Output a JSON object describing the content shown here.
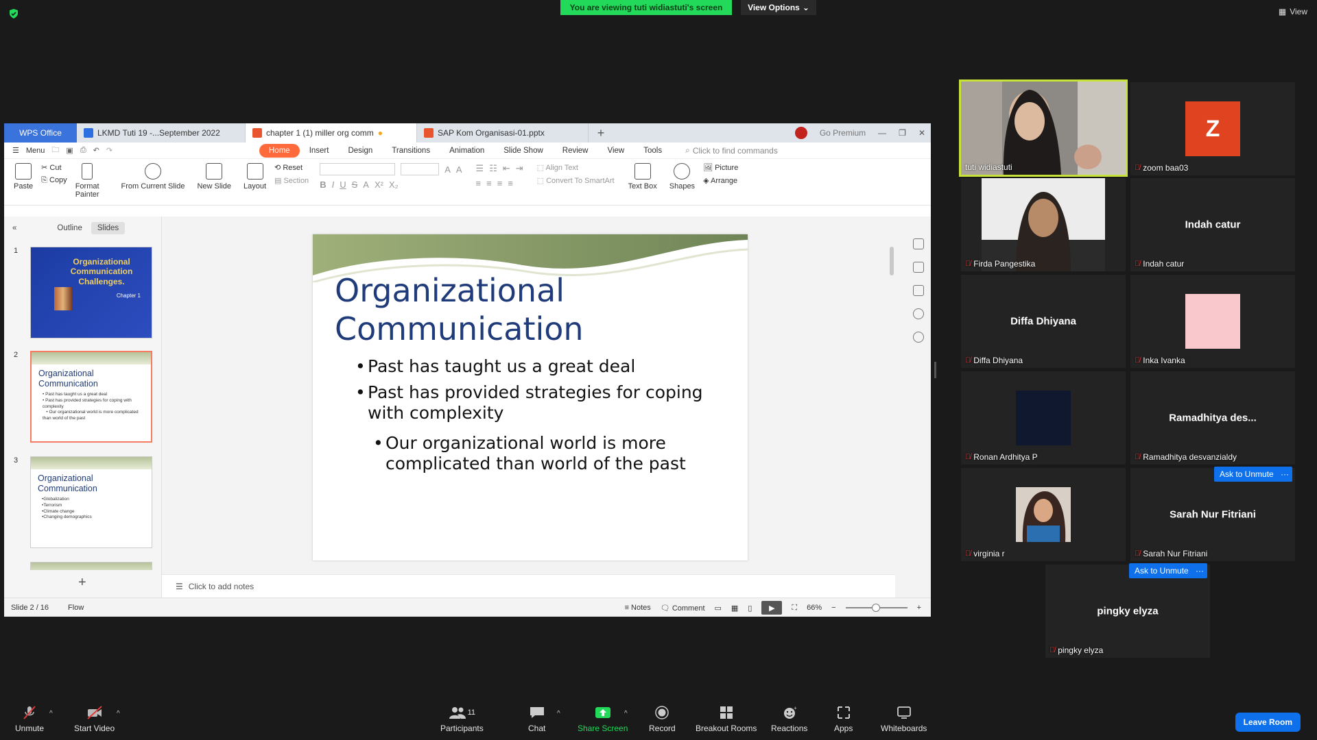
{
  "top": {
    "viewing_banner": "You are viewing tuti widiastuti's screen",
    "view_options": "View Options",
    "view": "View"
  },
  "wps": {
    "tabs": [
      {
        "label": "WPS Office"
      },
      {
        "label": "LKMD Tuti 19 -...September 2022"
      },
      {
        "label": "chapter 1 (1) miller org comm"
      },
      {
        "label": "SAP Kom Organisasi-01.pptx"
      }
    ],
    "premium": "Go Premium",
    "menu": "Menu",
    "ribbon_tabs": [
      "Home",
      "Insert",
      "Design",
      "Transitions",
      "Animation",
      "Slide Show",
      "Review",
      "View",
      "Tools"
    ],
    "find_placeholder": "Click to find commands",
    "toolbar": {
      "paste": "Paste",
      "cut": "Cut",
      "copy": "Copy",
      "format_painter_1": "Format",
      "format_painter_2": "Painter",
      "from_current_slide": "From Current Slide",
      "new_slide": "New Slide",
      "layout": "Layout",
      "reset": "Reset",
      "section": "Section",
      "align_text": "Align Text",
      "convert_smartart": "Convert To SmartArt",
      "text_box": "Text Box",
      "shapes": "Shapes",
      "picture": "Picture",
      "arrange": "Arrange"
    },
    "panel_tabs": [
      "Outline",
      "Slides"
    ],
    "thumbs": [
      {
        "num": "1",
        "title": "Organizational Communication Challenges.",
        "sub": "Chapter 1"
      },
      {
        "num": "2",
        "title": "Organizational Communication",
        "bullets": "• Past has taught us a great deal\n• Past has provided strategies for coping with complexity\n   • Our organizational world is more complicated than world of the past"
      },
      {
        "num": "3",
        "title": "Organizational Communication",
        "bullets": "•Globalization\n•Terrorism\n•Climate change\n•Changing demographics"
      }
    ],
    "slide": {
      "title_line1": "Organizational",
      "title_line2": "Communication",
      "bullet1": "Past has taught us a great deal",
      "bullet2a": "Past has provided strategies for coping",
      "bullet2b": "with complexity",
      "sub1a": "Our organizational world is more",
      "sub1b": "complicated than world of the past"
    },
    "notes_placeholder": "Click to add notes",
    "status": {
      "slide_count": "Slide 2 / 16",
      "flow": "Flow",
      "notes": "Notes",
      "comment": "Comment",
      "zoom": "66%"
    }
  },
  "participants": [
    {
      "name": "tuti widiastuti",
      "speaking": true
    },
    {
      "name": "zoom baa03",
      "avatar_letter": "Z"
    },
    {
      "name": "Firda Pangestika"
    },
    {
      "name": "Indah catur",
      "display": "Indah catur"
    },
    {
      "name": "Diffa Dhiyana",
      "display": "Diffa Dhiyana"
    },
    {
      "name": "Inka Ivanka"
    },
    {
      "name": "Ronan Ardhitya P"
    },
    {
      "name": "Ramadhitya desvanzialdy",
      "display": "Ramadhitya des..."
    },
    {
      "name": "virginia r"
    },
    {
      "name": "Sarah Nur Fitriani",
      "display": "Sarah Nur Fitriani"
    },
    {
      "name": "pingky elyza",
      "display": "pingky elyza"
    }
  ],
  "ask_to_unmute": "Ask to Unmute",
  "bottom_bar": {
    "unmute": "Unmute",
    "start_video": "Start Video",
    "participants": "Participants",
    "participants_count": "11",
    "chat": "Chat",
    "share_screen": "Share Screen",
    "record": "Record",
    "breakout_rooms": "Breakout Rooms",
    "reactions": "Reactions",
    "apps": "Apps",
    "whiteboards": "Whiteboards",
    "leave_room": "Leave Room"
  },
  "colors": {
    "share_green": "#23d959",
    "zoom_blue": "#0e71eb",
    "wps_orange": "#ff6a3d",
    "speaker_border": "#c7e339",
    "slide_title": "#1f3b7a"
  }
}
